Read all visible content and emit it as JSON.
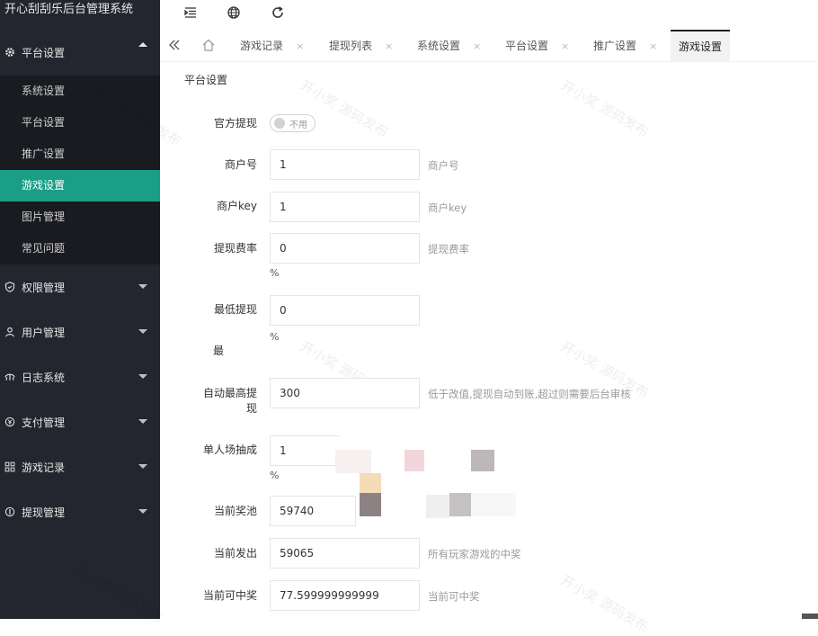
{
  "app": {
    "title": "开心刮刮乐后台管理系统"
  },
  "sidebar": {
    "groups": [
      {
        "label": "平台设置",
        "icon": "gear-icon",
        "expanded": true,
        "items": [
          {
            "label": "系统设置"
          },
          {
            "label": "平台设置"
          },
          {
            "label": "推广设置"
          },
          {
            "label": "游戏设置",
            "active": true
          },
          {
            "label": "图片管理"
          },
          {
            "label": "常见问题"
          }
        ]
      },
      {
        "label": "权限管理",
        "icon": "shield-icon"
      },
      {
        "label": "用户管理",
        "icon": "user-icon"
      },
      {
        "label": "日志系统",
        "icon": "log-icon"
      },
      {
        "label": "支付管理",
        "icon": "pay-icon"
      },
      {
        "label": "游戏记录",
        "icon": "grid-icon"
      },
      {
        "label": "提现管理",
        "icon": "coin-icon"
      }
    ]
  },
  "tabs": [
    {
      "label": "游戏记录"
    },
    {
      "label": "提现列表"
    },
    {
      "label": "系统设置"
    },
    {
      "label": "平台设置"
    },
    {
      "label": "推广设置"
    },
    {
      "label": "游戏设置",
      "active": true
    }
  ],
  "tab_close": "×",
  "form": {
    "section_title": "平台设置",
    "official_withdraw": {
      "label": "官方提现",
      "switch_text": "不用"
    },
    "merchant_no": {
      "label": "商户号",
      "value": "1",
      "hint": "商户号"
    },
    "merchant_key": {
      "label": "商户key",
      "value": "1",
      "hint": "商户key"
    },
    "withdraw_rate": {
      "label": "提现费率",
      "value": "0",
      "hint": "提现费率",
      "unit": "%"
    },
    "min_withdraw": {
      "label_line1": "最低提现",
      "label_line2": "最",
      "value": "0",
      "unit": "%"
    },
    "auto_max_withdraw": {
      "label_line1": "自动最高提",
      "label_line2": "现",
      "value": "300",
      "hint": "低于改值,提现自动到账,超过则需要后台审核"
    },
    "single_commission": {
      "label": "单人场抽成",
      "value": "1",
      "unit": "%"
    },
    "current_pool": {
      "label": "当前奖池",
      "value": "59740"
    },
    "current_paid": {
      "label": "当前发出",
      "value": "59065",
      "hint": "所有玩家游戏的中奖"
    },
    "current_winnable": {
      "label": "当前可中奖",
      "value": "77.599999999999",
      "hint": "当前可中奖"
    }
  },
  "watermark": {
    "text": "开小奖 源码发布"
  }
}
